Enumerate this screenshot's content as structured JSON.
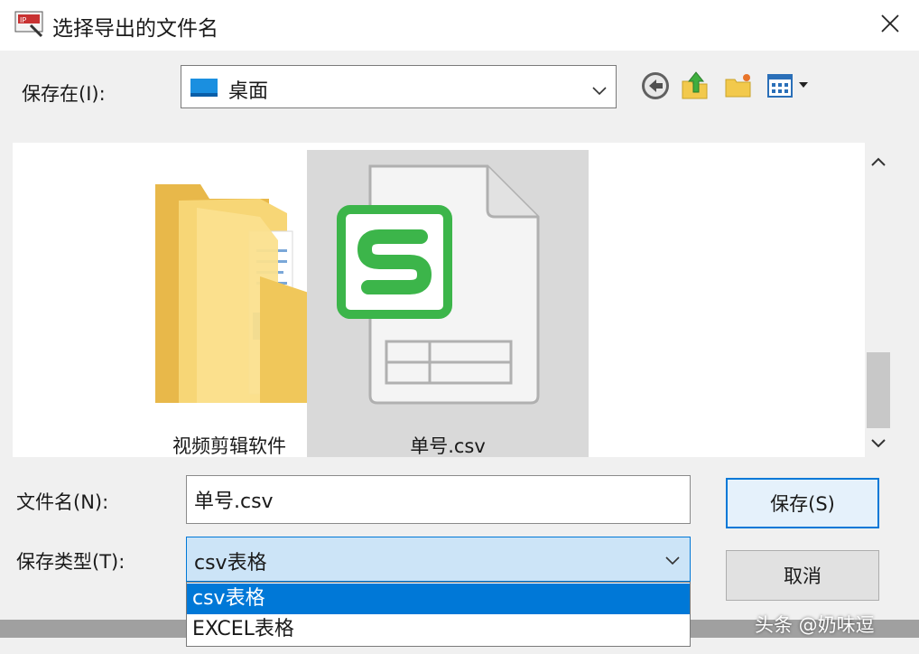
{
  "window": {
    "title": "选择导出的文件名",
    "app_icon": "app-logo-icon",
    "close_icon": "close-icon"
  },
  "save_in": {
    "label": "保存在(I):",
    "location": "桌面",
    "location_icon": "desktop-icon"
  },
  "toolbar": {
    "icons": [
      "back-icon",
      "up-folder-icon",
      "new-folder-icon",
      "view-menu-icon"
    ]
  },
  "files": [
    {
      "name": "视频剪辑软件",
      "icon": "folder-icon"
    },
    {
      "name": "单号.csv",
      "icon": "spreadsheet-file-icon",
      "selected": true
    }
  ],
  "form": {
    "filename_label": "文件名(N):",
    "filename_value": "单号.csv",
    "type_label": "保存类型(T):",
    "type_value": "csv表格",
    "type_options": [
      "csv表格",
      "EXCEL表格"
    ]
  },
  "buttons": {
    "save": "保存(S)",
    "cancel": "取消"
  },
  "watermark": "头条 @奶味逗",
  "colors": {
    "accent": "#0078d7",
    "selection": "#d9d9d9",
    "wps_green": "#3cb54a"
  }
}
